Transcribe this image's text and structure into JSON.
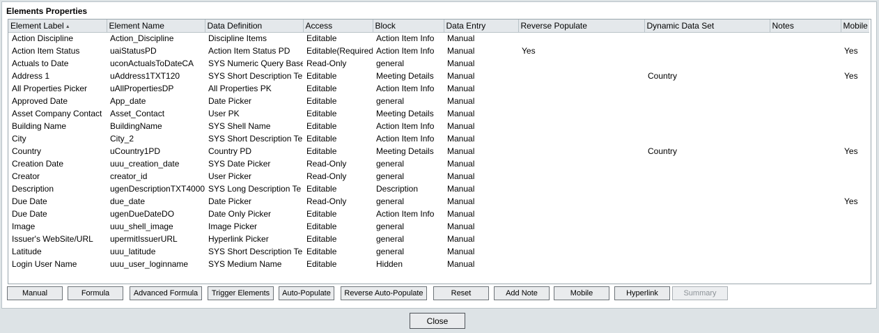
{
  "dialog": {
    "title": "Elements Properties",
    "close_label": "Close"
  },
  "columns": [
    "Element Label",
    "Element Name",
    "Data Definition",
    "Access",
    "Block",
    "Data Entry",
    "Reverse Populate",
    "Dynamic Data Set",
    "Notes",
    "Mobile"
  ],
  "sort": {
    "column": "Element Label",
    "direction": "ascending",
    "icon": "sort-ascending-icon"
  },
  "rows": [
    [
      "Action Discipline",
      "Action_Discipline",
      "Discipline Items",
      "Editable",
      "Action Item Info",
      "Manual",
      "",
      "",
      "",
      ""
    ],
    [
      "Action Item Status",
      "uaiStatusPD",
      "Action Item Status PD",
      "Editable(Required",
      "Action Item Info",
      "Manual",
      "Yes",
      "",
      "",
      "Yes"
    ],
    [
      "Actuals to Date",
      "uconActualsToDateCA",
      "SYS Numeric Query Base",
      "Read-Only",
      "general",
      "Manual",
      "",
      "",
      "",
      ""
    ],
    [
      "Address 1",
      "uAddress1TXT120",
      "SYS Short Description Te",
      "Editable",
      "Meeting Details",
      "Manual",
      "",
      "Country",
      "",
      "Yes"
    ],
    [
      "All Properties Picker",
      "uAllPropertiesDP",
      "All Properties PK",
      "Editable",
      "Action Item Info",
      "Manual",
      "",
      "",
      "",
      ""
    ],
    [
      "Approved Date",
      "App_date",
      "Date Picker",
      "Editable",
      "general",
      "Manual",
      "",
      "",
      "",
      ""
    ],
    [
      "Asset Company Contact",
      "Asset_Contact",
      "User PK",
      "Editable",
      "Meeting Details",
      "Manual",
      "",
      "",
      "",
      ""
    ],
    [
      "Building Name",
      "BuildingName",
      "SYS Shell Name",
      "Editable",
      "Action Item Info",
      "Manual",
      "",
      "",
      "",
      ""
    ],
    [
      "City",
      "City_2",
      "SYS Short Description Te",
      "Editable",
      "Action Item Info",
      "Manual",
      "",
      "",
      "",
      ""
    ],
    [
      "Country",
      "uCountry1PD",
      "Country PD",
      "Editable",
      "Meeting Details",
      "Manual",
      "",
      "Country",
      "",
      "Yes"
    ],
    [
      "Creation Date",
      "uuu_creation_date",
      "SYS Date Picker",
      "Read-Only",
      "general",
      "Manual",
      "",
      "",
      "",
      ""
    ],
    [
      "Creator",
      "creator_id",
      "User Picker",
      "Read-Only",
      "general",
      "Manual",
      "",
      "",
      "",
      ""
    ],
    [
      "Description",
      "ugenDescriptionTXT4000",
      "SYS Long Description Te",
      "Editable",
      "Description",
      "Manual",
      "",
      "",
      "",
      ""
    ],
    [
      "Due Date",
      "due_date",
      "Date Picker",
      "Read-Only",
      "general",
      "Manual",
      "",
      "",
      "",
      "Yes"
    ],
    [
      "Due Date",
      "ugenDueDateDO",
      "Date Only Picker",
      "Editable",
      "Action Item Info",
      "Manual",
      "",
      "",
      "",
      ""
    ],
    [
      "Image",
      "uuu_shell_image",
      "Image Picker",
      "Editable",
      "general",
      "Manual",
      "",
      "",
      "",
      ""
    ],
    [
      "Issuer's WebSite/URL",
      "upermitIssuerURL",
      "Hyperlink Picker",
      "Editable",
      "general",
      "Manual",
      "",
      "",
      "",
      ""
    ],
    [
      "Latitude",
      "uuu_latitude",
      "SYS Short Description Te",
      "Editable",
      "general",
      "Manual",
      "",
      "",
      "",
      ""
    ],
    [
      "Login User Name",
      "uuu_user_loginname",
      "SYS Medium Name",
      "Editable",
      "Hidden",
      "Manual",
      "",
      "",
      "",
      ""
    ]
  ],
  "buttons": [
    {
      "label": "Manual",
      "enabled": true
    },
    {
      "label": "Formula",
      "enabled": true
    },
    {
      "label": "Advanced Formula",
      "enabled": true
    },
    {
      "label": "Trigger Elements",
      "enabled": true
    },
    {
      "label": "Auto-Populate",
      "enabled": true
    },
    {
      "label": "Reverse Auto-Populate",
      "enabled": true
    },
    {
      "label": "Reset",
      "enabled": true
    },
    {
      "label": "Add Note",
      "enabled": true
    },
    {
      "label": "Mobile",
      "enabled": true
    },
    {
      "label": "Hyperlink",
      "enabled": true
    },
    {
      "label": "Summary",
      "enabled": false
    }
  ]
}
